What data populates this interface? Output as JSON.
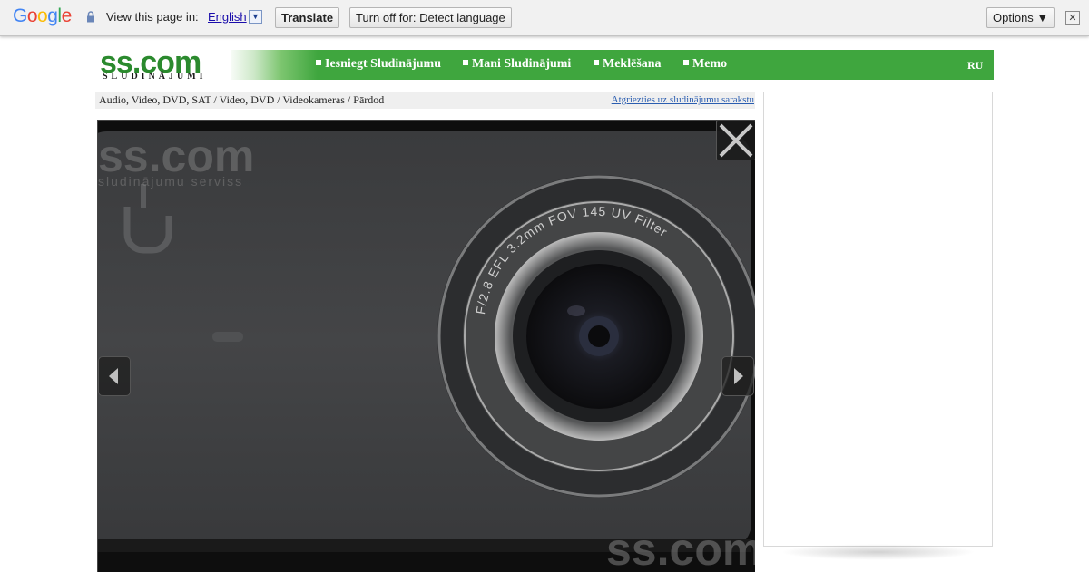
{
  "translate_bar": {
    "logo": "Google",
    "prompt": "View this page in:",
    "language": "English",
    "language_dropdown": "▼",
    "translate_button": "Translate",
    "turn_off_button": "Turn off for: Detect language",
    "options_button": "Options ▼",
    "close": "✕"
  },
  "header": {
    "logo_main": "ss.com",
    "logo_sub": "SLUDINĀJUMI",
    "nav": [
      {
        "label": "Iesniegt Sludinājumu"
      },
      {
        "label": "Mani Sludinājumi"
      },
      {
        "label": "Meklēšana"
      },
      {
        "label": "Memo"
      }
    ],
    "lang_switch": "RU",
    "brand_green": "#3fa63e"
  },
  "breadcrumb": {
    "path": "Audio, Video, DVD, SAT / Video, DVD / Videokameras / Pārdod",
    "back_link": "Atgriezties uz sludinājumu sarakstu"
  },
  "photo": {
    "watermark_main": "ss.com",
    "watermark_sub": "sludinājumu serviss",
    "lens_ring_text": "F/2.8   EFL 3.2mm   FOV 145   UV Filter",
    "icons": [
      "arrow-left-icon",
      "arrow-right-icon",
      "close-icon"
    ]
  }
}
